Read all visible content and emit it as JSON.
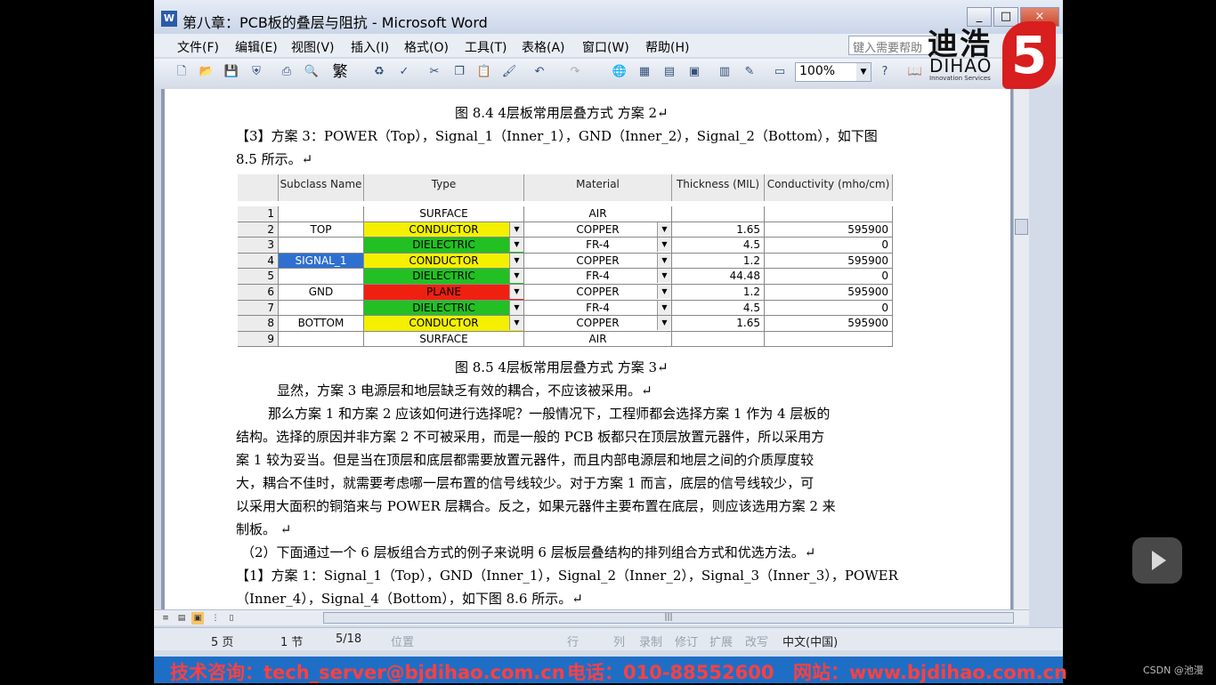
{
  "window": {
    "title": "第八章：PCB板的叠层与阻抗 - Microsoft Word",
    "app_icon": "W",
    "buttons": [
      "_",
      "□",
      "×"
    ]
  },
  "menu": [
    "文件(F)",
    "编辑(E)",
    "视图(V)",
    "插入(I)",
    "格式(O)",
    "工具(T)",
    "表格(A)",
    "窗口(W)",
    "帮助(H)"
  ],
  "help_box": {
    "placeholder": "键入需要帮助"
  },
  "toolbar": {
    "zoom": "100%",
    "font_button": "繁"
  },
  "logo": {
    "cn": "迪浩",
    "en": "DIHAO",
    "sub": "Innovation Services",
    "mark": "5"
  },
  "document": {
    "caption_1": "图 8.4  4层板常用层叠方式 方案 2↵",
    "para_1": "【3】方案 3：POWER（Top），Signal_1（Inner_1），GND（Inner_2），Signal_2（Bottom），如下图",
    "para_1b": "8.5 所示。↵",
    "caption_2": "图 8.5  4层板常用层叠方式 方案 3↵",
    "para_2": "显然，方案 3 电源层和地层缺乏有效的耦合，不应该被采用。↵",
    "para_3_lines": [
      "那么方案 1 和方案 2 应该如何进行选择呢？一般情况下，工程师都会选择方案 1 作为 4 层板的",
      "结构。选择的原因并非方案 2 不可被采用，而是一般的 PCB 板都只在顶层放置元器件，所以采用方",
      "案 1 较为妥当。但是当在顶层和底层都需要放置元器件，而且内部电源层和地层之间的介质厚度较",
      "大，耦合不佳时，就需要考虑哪一层布置的信号线较少。对于方案 1 而言，底层的信号线较少，可",
      "以采用大面积的铜箔来与 POWER 层耦合。反之，如果元器件主要布置在底层，则应该选用方案 2 来",
      "制板。  ↵"
    ],
    "para_4": "（2）下面通过一个 6 层板组合方式的例子来说明 6 层板层叠结构的排列组合方式和优选方法。↵",
    "para_5": "【1】方案 1：Signal_1（Top），GND（Inner_1），Signal_2（Inner_2），Signal_3（Inner_3），POWER",
    "para_5b": "（Inner_4），Signal_4（Bottom），如下图 8.6 所示。↵"
  },
  "stack_table": {
    "headers": [
      "",
      "Subclass Name",
      "Type",
      "Material",
      "Thickness (MIL)",
      "Conductivity (mho/cm)"
    ],
    "rows": [
      {
        "n": "1",
        "name": "",
        "type": "SURFACE",
        "material": "AIR",
        "thickness": "",
        "cond": "",
        "color": "#ffffff",
        "dd": false
      },
      {
        "n": "2",
        "name": "TOP",
        "type": "CONDUCTOR",
        "material": "COPPER",
        "thickness": "1.65",
        "cond": "595900",
        "color": "#f4f000",
        "dd": true
      },
      {
        "n": "3",
        "name": "",
        "type": "DIELECTRIC",
        "material": "FR-4",
        "thickness": "4.5",
        "cond": "0",
        "color": "#22c022",
        "dd": true
      },
      {
        "n": "4",
        "name": "SIGNAL_1",
        "type": "CONDUCTOR",
        "material": "COPPER",
        "thickness": "1.2",
        "cond": "595900",
        "color": "#f4f000",
        "dd": true,
        "name_selected": true
      },
      {
        "n": "5",
        "name": "",
        "type": "DIELECTRIC",
        "material": "FR-4",
        "thickness": "44.48",
        "cond": "0",
        "color": "#22c022",
        "dd": true
      },
      {
        "n": "6",
        "name": "GND",
        "type": "PLANE",
        "material": "COPPER",
        "thickness": "1.2",
        "cond": "595900",
        "color": "#f02010",
        "dd": true
      },
      {
        "n": "7",
        "name": "",
        "type": "DIELECTRIC",
        "material": "FR-4",
        "thickness": "4.5",
        "cond": "0",
        "color": "#22c022",
        "dd": true
      },
      {
        "n": "8",
        "name": "BOTTOM",
        "type": "CONDUCTOR",
        "material": "COPPER",
        "thickness": "1.65",
        "cond": "595900",
        "color": "#f4f000",
        "dd": true
      },
      {
        "n": "9",
        "name": "",
        "type": "SURFACE",
        "material": "AIR",
        "thickness": "",
        "cond": "",
        "color": "#ffffff",
        "dd": false
      }
    ]
  },
  "status": {
    "page": "5 页",
    "section": "1 节",
    "pages": "5/18",
    "position": "位置",
    "row": "行",
    "col": "列",
    "rec": "录制",
    "rev": "修订",
    "ext": "扩展",
    "ovr": "改写",
    "lang": "中文(中国)"
  },
  "banner": {
    "tech": "技术咨询：tech_server@bjdihao.com.cn",
    "phone": "电话：010-88552600",
    "site": "网站：www.bjdihao.com.cn"
  },
  "watermark": "CSDN @池漫"
}
